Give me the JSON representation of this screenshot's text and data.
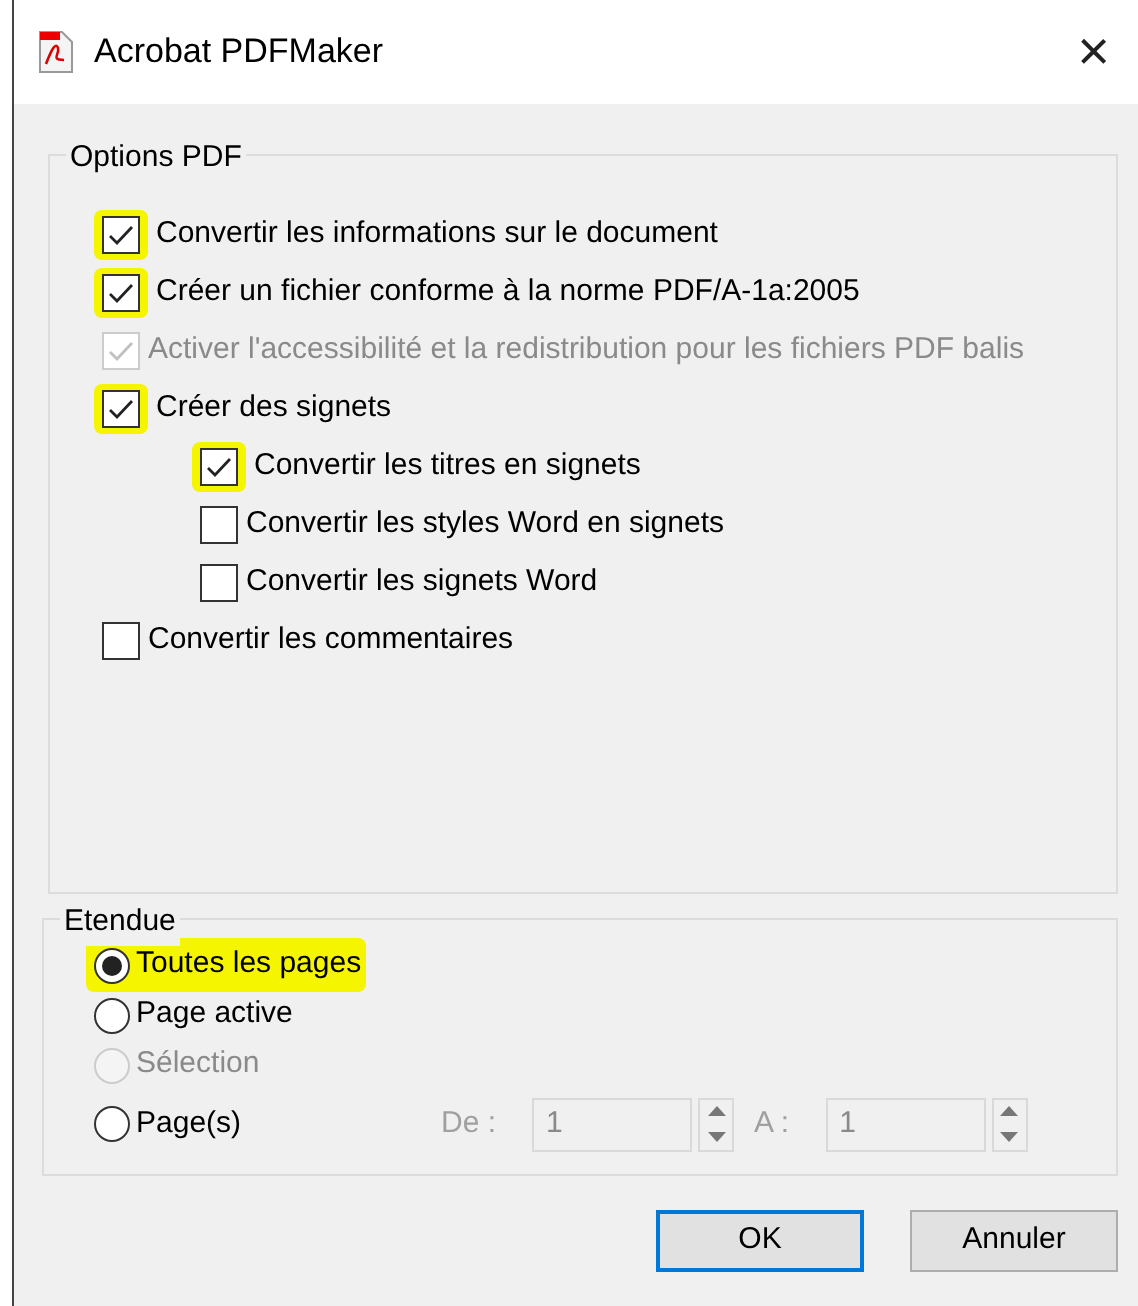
{
  "window": {
    "title": "Acrobat PDFMaker",
    "close": "×"
  },
  "options": {
    "title": "Options PDF",
    "items": [
      {
        "label": "Convertir les informations sur le document",
        "checked": true,
        "disabled": false,
        "highlighted": true
      },
      {
        "label": "Créer un fichier conforme à la norme PDF/A-1a:2005",
        "checked": true,
        "disabled": false,
        "highlighted": true
      },
      {
        "label": "Activer l'accessibilité et la redistribution pour les fichiers PDF balis",
        "checked": true,
        "disabled": true,
        "highlighted": false
      },
      {
        "label": "Créer des signets",
        "checked": true,
        "disabled": false,
        "highlighted": true,
        "children": [
          {
            "label": "Convertir les titres en signets",
            "checked": true,
            "disabled": false,
            "highlighted": true
          },
          {
            "label": "Convertir les styles Word en signets",
            "checked": false,
            "disabled": false,
            "highlighted": false
          },
          {
            "label": "Convertir les signets Word",
            "checked": false,
            "disabled": false,
            "highlighted": false
          }
        ]
      },
      {
        "label": "Convertir les commentaires",
        "checked": false,
        "disabled": false,
        "highlighted": false
      }
    ]
  },
  "range": {
    "title": "Etendue",
    "options": [
      {
        "label": "Toutes les pages",
        "selected": true,
        "disabled": false,
        "highlighted": true
      },
      {
        "label": "Page active",
        "selected": false,
        "disabled": false,
        "highlighted": false
      },
      {
        "label": "Sélection",
        "selected": false,
        "disabled": true,
        "highlighted": false
      },
      {
        "label": "Page(s)",
        "selected": false,
        "disabled": false,
        "highlighted": false
      }
    ],
    "from": {
      "label": "De :",
      "value": "1",
      "disabled": true
    },
    "to": {
      "label": "A :",
      "value": "1",
      "disabled": true
    }
  },
  "buttons": [
    {
      "label": "OK",
      "default": true
    },
    {
      "label": "Annuler",
      "default": false
    }
  ]
}
